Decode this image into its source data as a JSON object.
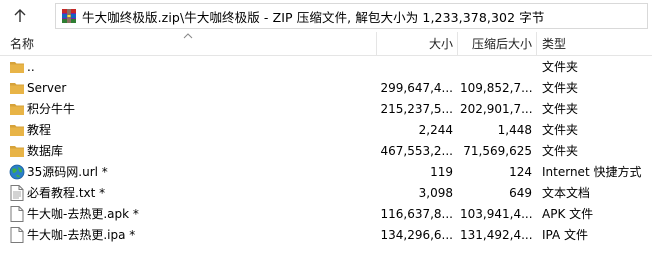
{
  "toolbar": {
    "up_icon": "up-arrow-icon",
    "archive_icon": "winrar-archive-icon",
    "path": "牛大咖终极版.zip\\牛大咖终极版 - ZIP 压缩文件, 解包大小为 1,233,378,302 字节"
  },
  "columns": {
    "name": "名称",
    "size": "大小",
    "packed": "压缩后大小",
    "type": "类型"
  },
  "colors": {
    "folder": "#e8b447",
    "folder_dark": "#d6a23a",
    "globe": "#2a7fc8",
    "doc_border": "#7a7a7a"
  },
  "files": [
    {
      "icon": "folder-icon",
      "name": "..",
      "size": "",
      "packed": "",
      "type": "文件夹"
    },
    {
      "icon": "folder-icon",
      "name": "Server",
      "size": "299,647,4...",
      "packed": "109,852,7...",
      "type": "文件夹"
    },
    {
      "icon": "folder-icon",
      "name": "积分牛牛",
      "size": "215,237,5...",
      "packed": "202,901,7...",
      "type": "文件夹"
    },
    {
      "icon": "folder-icon",
      "name": "教程",
      "size": "2,244",
      "packed": "1,448",
      "type": "文件夹"
    },
    {
      "icon": "folder-icon",
      "name": "数据库",
      "size": "467,553,2...",
      "packed": "71,569,625",
      "type": "文件夹"
    },
    {
      "icon": "internet-shortcut-icon",
      "name": "35源码网.url *",
      "size": "119",
      "packed": "124",
      "type": "Internet 快捷方式"
    },
    {
      "icon": "text-file-icon",
      "name": "必看教程.txt *",
      "size": "3,098",
      "packed": "649",
      "type": "文本文档"
    },
    {
      "icon": "file-icon",
      "name": "牛大咖-去热更.apk *",
      "size": "116,637,8...",
      "packed": "103,941,4...",
      "type": "APK 文件"
    },
    {
      "icon": "file-icon",
      "name": "牛大咖-去热更.ipa *",
      "size": "134,296,6...",
      "packed": "131,492,4...",
      "type": "IPA 文件"
    }
  ]
}
